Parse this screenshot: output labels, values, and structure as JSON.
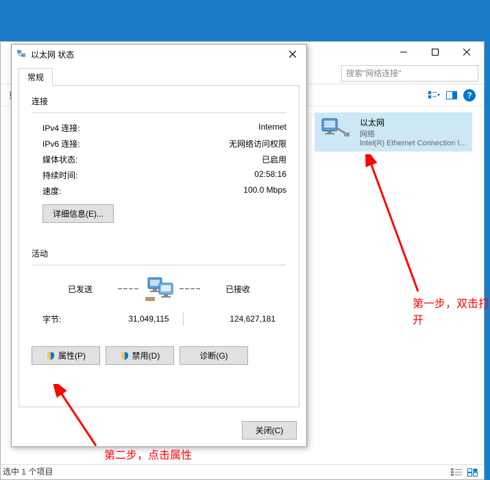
{
  "explorer": {
    "search_placeholder": "搜索\"网络连接\"",
    "toolbar": {
      "change_settings": "更改此连接的设置"
    },
    "item": {
      "name": "以太网",
      "subtitle": "网络",
      "device": "Intel(R) Ethernet Connection I2..."
    },
    "status_text": "选中 1 个项目"
  },
  "dialog": {
    "title": "以太网 状态",
    "tab": "常规",
    "connection_section": "连接",
    "rows": {
      "ipv4_label": "IPv4 连接:",
      "ipv4_value": "Internet",
      "ipv6_label": "IPv6 连接:",
      "ipv6_value": "无网络访问权限",
      "media_label": "媒体状态:",
      "media_value": "已启用",
      "duration_label": "持续时间:",
      "duration_value": "02:58:16",
      "speed_label": "速度:",
      "speed_value": "100.0 Mbps"
    },
    "details_btn": "详细信息(E)...",
    "activity_section": "活动",
    "activity": {
      "sent": "已发送",
      "received": "已接收",
      "bytes_label": "字节:",
      "bytes_sent": "31,049,115",
      "bytes_received": "124,627,181"
    },
    "buttons": {
      "properties": "属性(P)",
      "disable": "禁用(D)",
      "diagnose": "诊断(G)",
      "close": "关闭(C)"
    }
  },
  "annotations": {
    "step1": "第一步，双击打开",
    "step2": "第二步，点击属性"
  },
  "edge": {
    "l1": "以\n已"
  }
}
